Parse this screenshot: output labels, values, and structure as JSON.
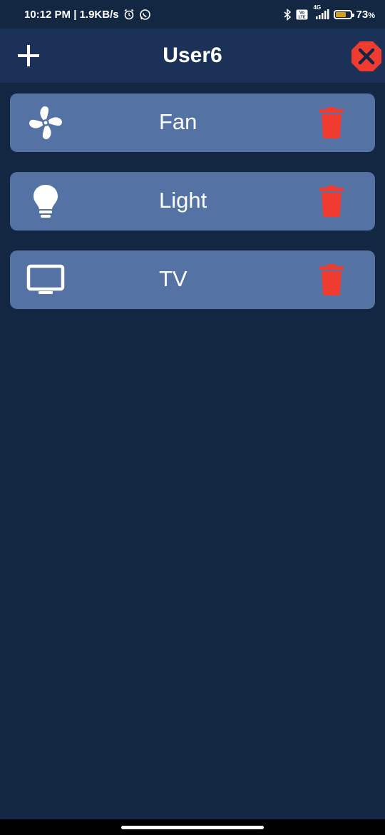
{
  "status_bar": {
    "time_speed": "10:12 PM | 1.9KB/s",
    "network_type": "4G",
    "volte": "Vo LTE",
    "battery_percent": "73",
    "battery_unit": "%",
    "battery_level": 0.73,
    "icons": [
      "alarm-icon",
      "whatsapp-icon",
      "bluetooth-icon",
      "volte-icon",
      "signal-icon",
      "battery-icon"
    ]
  },
  "app_bar": {
    "title": "User6",
    "add_icon": "plus-icon",
    "close_icon": "close-octagon-icon"
  },
  "devices": [
    {
      "label": "Fan",
      "icon": "fan-icon"
    },
    {
      "label": "Light",
      "icon": "lightbulb-icon"
    },
    {
      "label": "TV",
      "icon": "tv-icon"
    }
  ],
  "colors": {
    "background": "#132742",
    "app_bar": "#1b3157",
    "card": "#5473a4",
    "delete": "#f03b30",
    "close": "#f03b30"
  }
}
